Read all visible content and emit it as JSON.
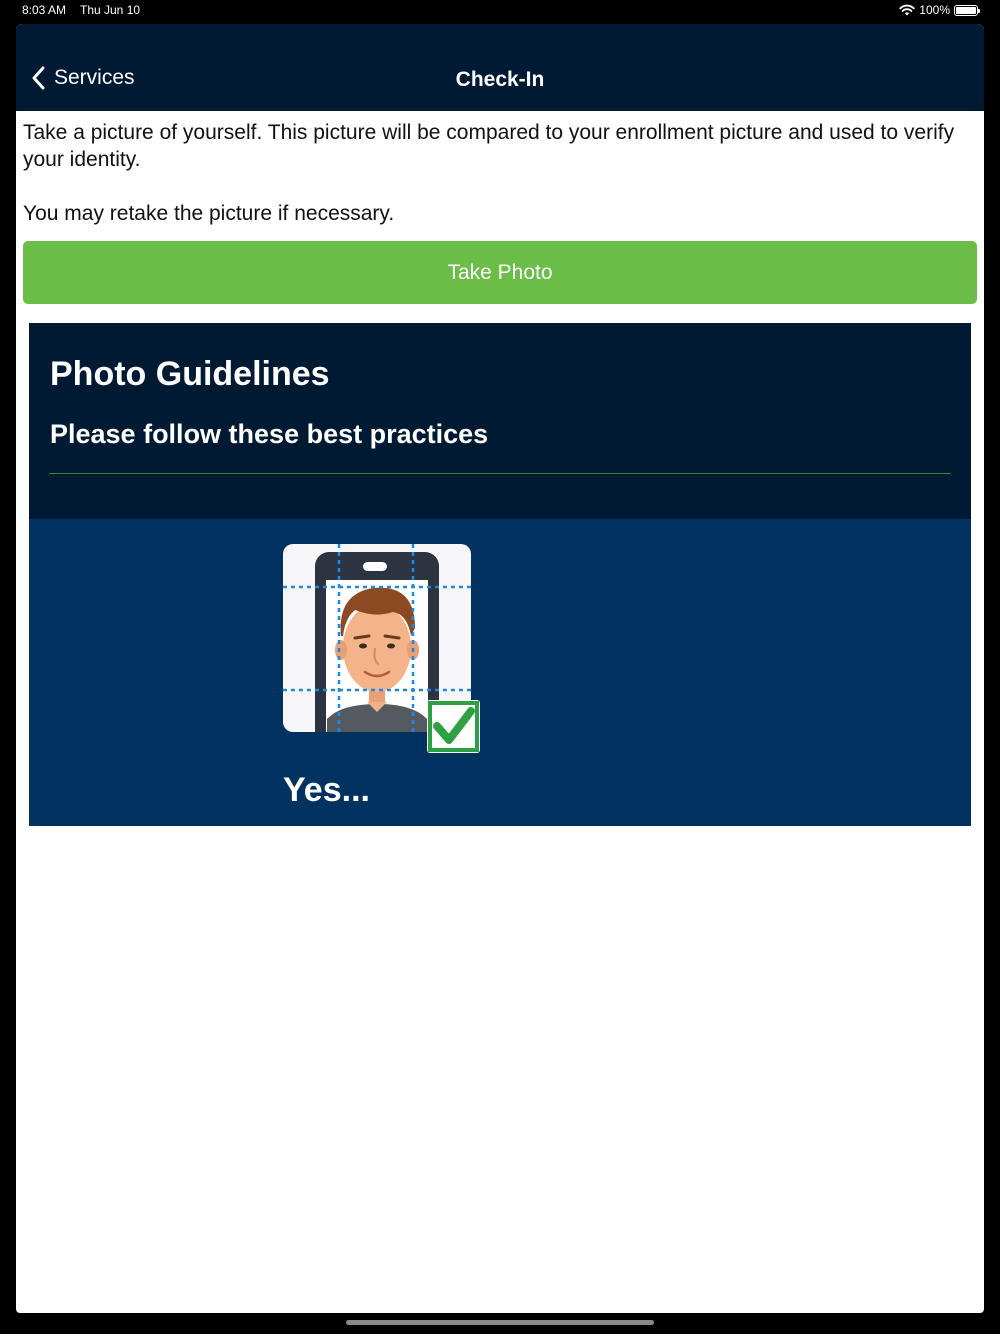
{
  "status_bar": {
    "time": "8:03 AM",
    "date": "Thu Jun 10",
    "battery": "100%",
    "icons": [
      "wifi-icon",
      "battery-icon"
    ]
  },
  "nav": {
    "back_label": "Services",
    "title": "Check-In"
  },
  "intro": {
    "paragraph1": "Take a picture of yourself. This picture will be compared to your enrollment picture and used to verify your identity.",
    "paragraph2": "You may retake the picture if necessary."
  },
  "actions": {
    "take_photo_label": "Take Photo"
  },
  "guidelines": {
    "title": "Photo Guidelines",
    "subtitle": "Please follow these best practices",
    "example_label": "Yes..."
  },
  "colors": {
    "nav_background": "#011a34",
    "primary_button": "#6abe47",
    "guideline_body": "#023360"
  }
}
